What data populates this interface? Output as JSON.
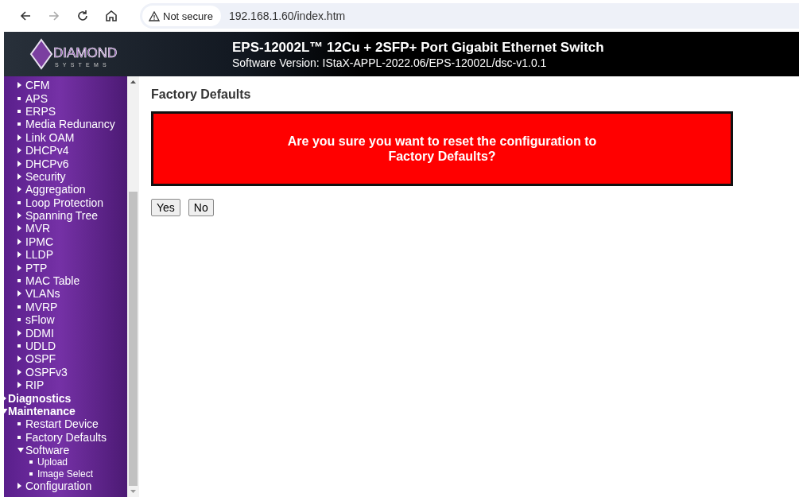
{
  "browser": {
    "security": "Not secure",
    "url": "192.168.1.60/index.htm",
    "forward_disabled": true
  },
  "header": {
    "logo": {
      "name": "DIAMOND",
      "tagline": "SYSTEMS"
    },
    "title": "EPS-12002L™ 12Cu + 2SFP+ Port Gigabit Ethernet Switch",
    "subtitle": "Software Version: IStaX-APPL-2022.06/EPS-12002L/dsc-v1.0.1"
  },
  "sidebar": {
    "sections": [
      {
        "items": [
          {
            "kind": "folder",
            "label": "CFM",
            "expanded": false
          },
          {
            "kind": "page",
            "label": "APS"
          },
          {
            "kind": "page",
            "label": "ERPS"
          },
          {
            "kind": "page",
            "label": "Media Redunancy"
          },
          {
            "kind": "folder",
            "label": "Link OAM",
            "expanded": false
          },
          {
            "kind": "folder",
            "label": "DHCPv4",
            "expanded": false
          },
          {
            "kind": "folder",
            "label": "DHCPv6",
            "expanded": false
          },
          {
            "kind": "folder",
            "label": "Security",
            "expanded": false
          },
          {
            "kind": "folder",
            "label": "Aggregation",
            "expanded": false
          },
          {
            "kind": "page",
            "label": "Loop Protection"
          },
          {
            "kind": "folder",
            "label": "Spanning Tree",
            "expanded": false
          },
          {
            "kind": "folder",
            "label": "MVR",
            "expanded": false
          },
          {
            "kind": "folder",
            "label": "IPMC",
            "expanded": false
          },
          {
            "kind": "folder",
            "label": "LLDP",
            "expanded": false
          },
          {
            "kind": "folder",
            "label": "PTP",
            "expanded": false
          },
          {
            "kind": "page",
            "label": "MAC Table"
          },
          {
            "kind": "folder",
            "label": "VLANs",
            "expanded": false
          },
          {
            "kind": "page",
            "label": "MVRP"
          },
          {
            "kind": "page",
            "label": "sFlow"
          },
          {
            "kind": "folder",
            "label": "DDMI",
            "expanded": false
          },
          {
            "kind": "page",
            "label": "UDLD"
          },
          {
            "kind": "folder",
            "label": "OSPF",
            "expanded": false
          },
          {
            "kind": "folder",
            "label": "OSPFv3",
            "expanded": false
          },
          {
            "kind": "folder",
            "label": "RIP",
            "expanded": false
          }
        ]
      },
      {
        "title": "Diagnostics",
        "expanded": false
      },
      {
        "title": "Maintenance",
        "expanded": true,
        "items": [
          {
            "kind": "page",
            "label": "Restart Device"
          },
          {
            "kind": "page",
            "label": "Factory Defaults"
          },
          {
            "kind": "folder",
            "label": "Software",
            "expanded": true,
            "children": [
              {
                "kind": "page",
                "label": "Upload"
              },
              {
                "kind": "page",
                "label": "Image Select"
              }
            ]
          },
          {
            "kind": "folder",
            "label": "Configuration",
            "expanded": false
          }
        ]
      }
    ]
  },
  "main": {
    "title": "Factory Defaults",
    "warning": "Are you sure you want to reset the configuration to Factory Defaults?",
    "buttons": [
      "Yes",
      "No"
    ]
  }
}
